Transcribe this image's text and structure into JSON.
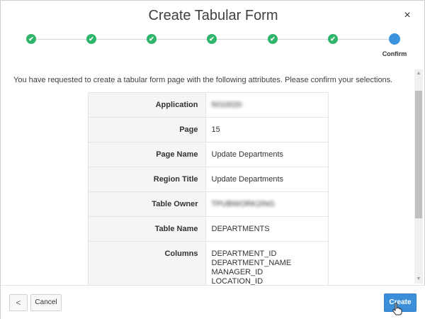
{
  "dialog": {
    "title": "Create Tabular Form",
    "close_label": "×"
  },
  "wizard": {
    "steps": [
      {
        "state": "complete",
        "glyph": "✔"
      },
      {
        "state": "complete",
        "glyph": "✔"
      },
      {
        "state": "complete",
        "glyph": "✔"
      },
      {
        "state": "complete",
        "glyph": "✔"
      },
      {
        "state": "complete",
        "glyph": "✔"
      },
      {
        "state": "complete",
        "glyph": "✔"
      },
      {
        "state": "current",
        "glyph": ""
      }
    ],
    "current_label": "Confirm"
  },
  "intro_text": "You have requested to create a tabular form page with the following attributes. Please confirm your selections.",
  "summary": {
    "rows": [
      {
        "label": "Application",
        "value": "5010020",
        "obscured": true
      },
      {
        "label": "Page",
        "value": "15"
      },
      {
        "label": "Page Name",
        "value": "Update Departments"
      },
      {
        "label": "Region Title",
        "value": "Update Departments"
      },
      {
        "label": "Table Owner",
        "value": "TPUBWORK2ING",
        "obscured": true
      },
      {
        "label": "Table Name",
        "value": "DEPARTMENTS"
      }
    ],
    "columns_label": "Columns",
    "columns": [
      "DEPARTMENT_ID",
      "DEPARTMENT_NAME",
      "MANAGER_ID",
      "LOCATION_ID"
    ]
  },
  "footer": {
    "back_label": "<",
    "cancel_label": "Cancel",
    "create_label": "Create"
  },
  "colors": {
    "step_complete": "#2fb46b",
    "step_current": "#3b93dd",
    "primary_button": "#3b8fd9"
  }
}
